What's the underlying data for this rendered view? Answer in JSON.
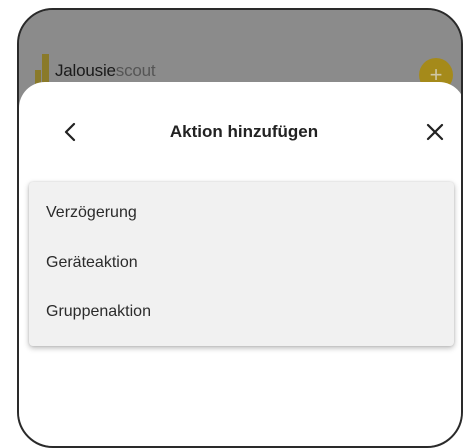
{
  "app": {
    "brand_bold": "Jalousie",
    "brand_light": "scout"
  },
  "sheet": {
    "title": "Aktion hinzufügen"
  },
  "menu": {
    "items": [
      {
        "label": "Verzögerung"
      },
      {
        "label": "Geräteaktion"
      },
      {
        "label": "Gruppenaktion"
      }
    ]
  },
  "colors": {
    "overlay": "#8b8b8b",
    "brand": "#a58a1a",
    "menu_bg": "#f1f1f1"
  },
  "icons": {
    "back": "chevron-left-icon",
    "close": "close-icon",
    "fab": "plus-icon",
    "logo": "jalousiescout-logo"
  }
}
